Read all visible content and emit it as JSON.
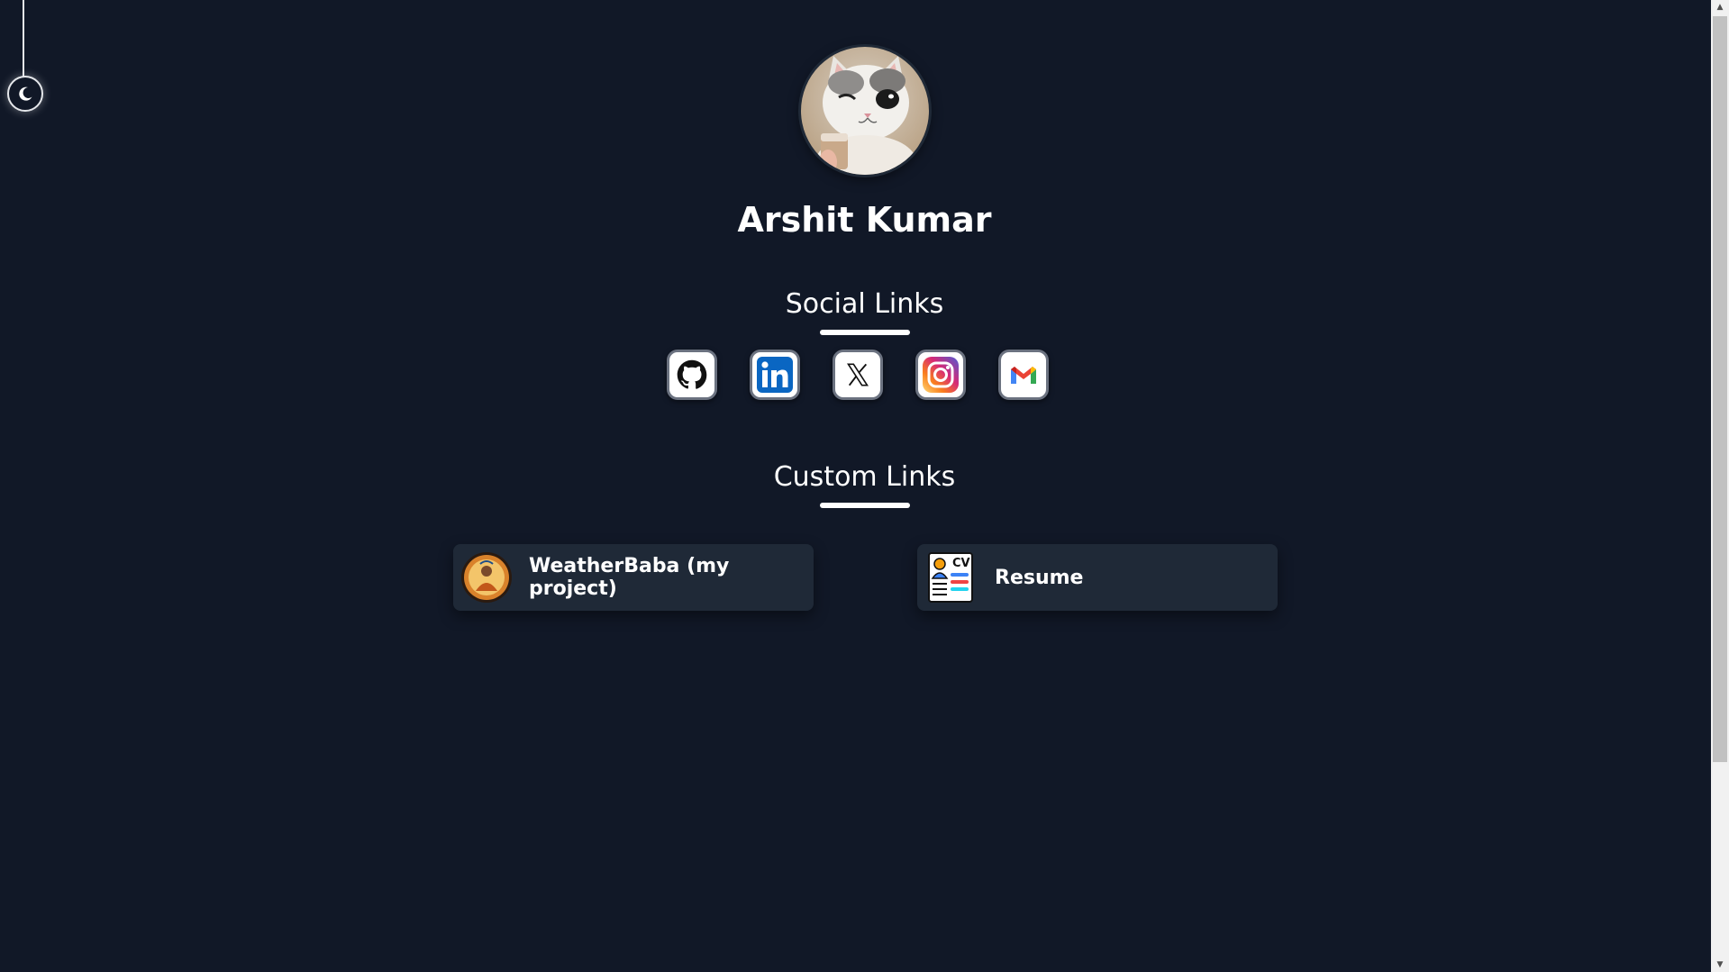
{
  "theme_toggle": {
    "icon": "moon-icon"
  },
  "profile": {
    "avatar_icon": "cat-photo-avatar",
    "name": "Arshit Kumar"
  },
  "social_section": {
    "title": "Social Links",
    "items": [
      {
        "icon": "github-icon"
      },
      {
        "icon": "linkedin-icon"
      },
      {
        "icon": "x-twitter-icon"
      },
      {
        "icon": "instagram-icon"
      },
      {
        "icon": "gmail-icon"
      }
    ]
  },
  "custom_section": {
    "title": "Custom Links",
    "items": [
      {
        "label": "WeatherBaba (my project)",
        "icon": "weatherbaba-logo-icon"
      },
      {
        "label": "Resume",
        "icon": "cv-document-icon"
      }
    ]
  },
  "colors": {
    "background": "#111827",
    "card": "#1f2937",
    "text": "#ffffff"
  },
  "scrollbar": {
    "up_arrow": "▲",
    "down_arrow": "▼"
  }
}
